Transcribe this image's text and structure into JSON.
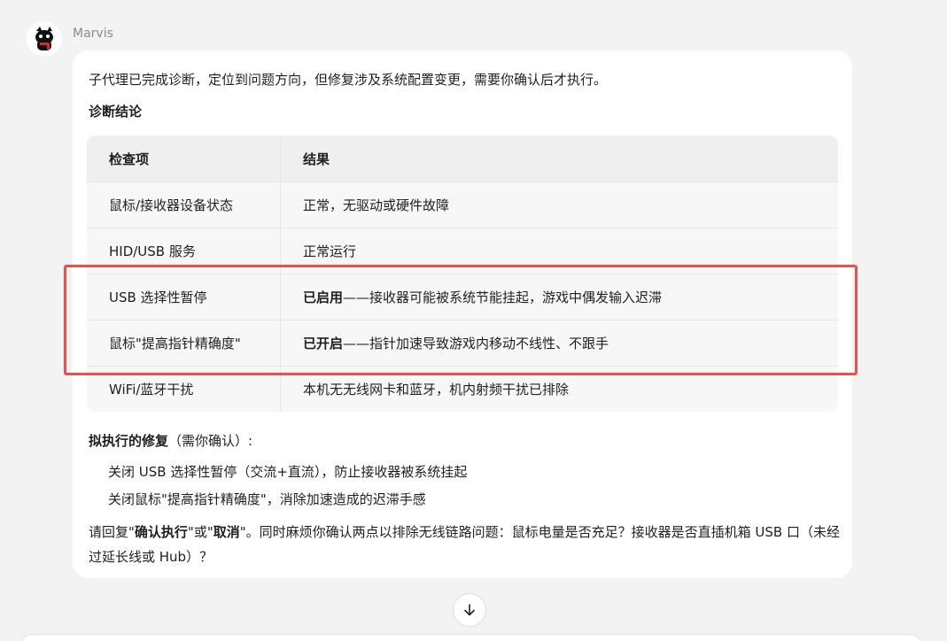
{
  "message": {
    "sender": "Marvis",
    "avatar_icon": "black-cat-avatar-icon",
    "intro": "子代理已完成诊断，定位到问题方向，但修复涉及系统配置变更，需要你确认后才执行。",
    "diagnosis_title": "诊断结论",
    "table": {
      "headers": [
        "检查项",
        "结果"
      ],
      "rows": [
        {
          "item": "鼠标/接收器设备状态",
          "result_bold": "",
          "result": "正常，无驱动或硬件故障"
        },
        {
          "item": "HID/USB 服务",
          "result_bold": "",
          "result": "正常运行"
        },
        {
          "item": "USB 选择性暂停",
          "result_bold": "已启用",
          "result": "——接收器可能被系统节能挂起，游戏中偶发输入迟滞"
        },
        {
          "item": "鼠标\"提高指针精确度\"",
          "result_bold": "已开启",
          "result": "——指针加速导致游戏内移动不线性、不跟手"
        },
        {
          "item": "WiFi/蓝牙干扰",
          "result_bold": "",
          "result": "本机无无线网卡和蓝牙，机内射频干扰已排除"
        }
      ]
    },
    "fix_title_bold": "拟执行的修复",
    "fix_title_rest": "（需你确认）:",
    "fixes": [
      "关闭 USB 选择性暂停（交流+直流），防止接收器被系统挂起",
      "关闭鼠标\"提高指针精确度\"，消除加速造成的迟滞手感"
    ],
    "reply": {
      "p1": "请回复\"",
      "confirm": "确认执行",
      "p2": "\"或\"",
      "cancel": "取消",
      "p3": "\"。同时麻烦你确认两点以排除无线链路问题：鼠标电量是否充足？接收器是否直插机箱 USB 口（未经过延长线或 Hub）？"
    }
  },
  "highlight_color": "#e5534b",
  "scroll_icon": "arrow-down-icon"
}
